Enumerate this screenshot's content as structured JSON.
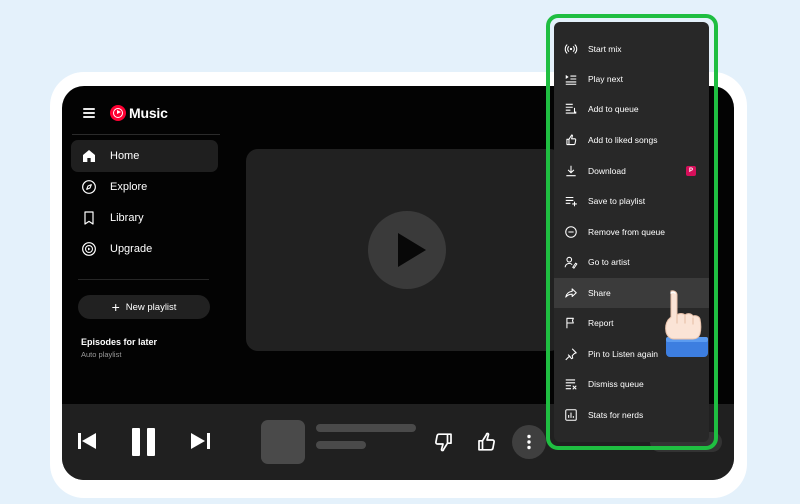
{
  "app": {
    "name": "Music"
  },
  "sidebar": {
    "items": [
      {
        "label": "Home",
        "icon": "home-icon",
        "active": true
      },
      {
        "label": "Explore",
        "icon": "compass-icon",
        "active": false
      },
      {
        "label": "Library",
        "icon": "library-icon",
        "active": false
      },
      {
        "label": "Upgrade",
        "icon": "upgrade-icon",
        "active": false
      }
    ],
    "new_playlist_label": "New playlist",
    "playlist": {
      "title": "Episodes for later",
      "subtitle": "Auto playlist"
    }
  },
  "context_menu": {
    "items": [
      {
        "label": "Start mix",
        "icon": "radio-icon"
      },
      {
        "label": "Play next",
        "icon": "play-next-icon"
      },
      {
        "label": "Add to queue",
        "icon": "add-to-queue-icon"
      },
      {
        "label": "Add to liked songs",
        "icon": "thumb-up-icon"
      },
      {
        "label": "Download",
        "icon": "download-icon",
        "badge": "P"
      },
      {
        "label": "Save to playlist",
        "icon": "playlist-add-icon"
      },
      {
        "label": "Remove from queue",
        "icon": "remove-circle-icon"
      },
      {
        "label": "Go to artist",
        "icon": "artist-icon"
      },
      {
        "label": "Share",
        "icon": "share-icon",
        "hovered": true
      },
      {
        "label": "Report",
        "icon": "flag-icon"
      },
      {
        "label": "Pin to Listen again",
        "icon": "pin-icon"
      },
      {
        "label": "Dismiss queue",
        "icon": "dismiss-queue-icon"
      },
      {
        "label": "Stats for nerds",
        "icon": "stats-icon"
      }
    ]
  },
  "colors": {
    "highlight": "#1fbe41",
    "brand": "#ff0033",
    "premium": "#d60f5a"
  }
}
